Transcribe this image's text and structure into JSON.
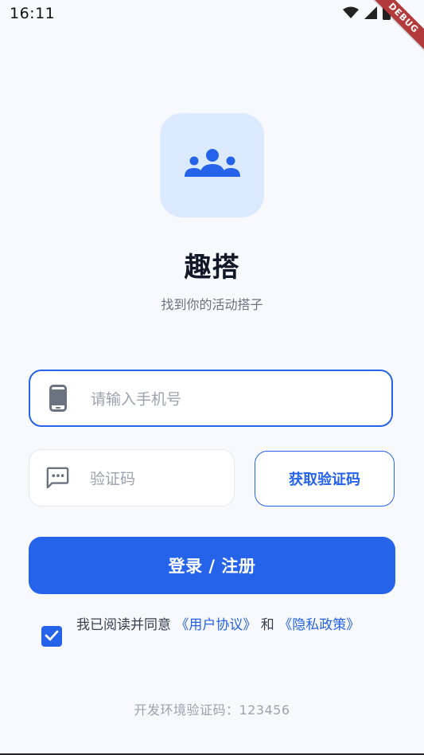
{
  "status_bar": {
    "time": "16:11",
    "icons": [
      "wifi-icon",
      "signal-icon",
      "battery-icon"
    ],
    "debug_label": "DEBUG"
  },
  "brand": {
    "logo_icon": "group-icon",
    "title": "趣搭",
    "subtitle": "找到你的活动搭子"
  },
  "form": {
    "phone_placeholder": "请输入手机号",
    "code_placeholder": "验证码",
    "get_code_label": "获取验证码",
    "submit_label": "登录 / 注册"
  },
  "agreement": {
    "checked": true,
    "prefix": "我已阅读并同意 ",
    "user_agreement": "《用户协议》",
    "and": " 和 ",
    "privacy_policy": "《隐私政策》"
  },
  "dev_note": "开发环境验证码：123456",
  "colors": {
    "primary": "#2563EB",
    "logo_bg": "#DBEAFE",
    "background": "#F7F9FC"
  }
}
